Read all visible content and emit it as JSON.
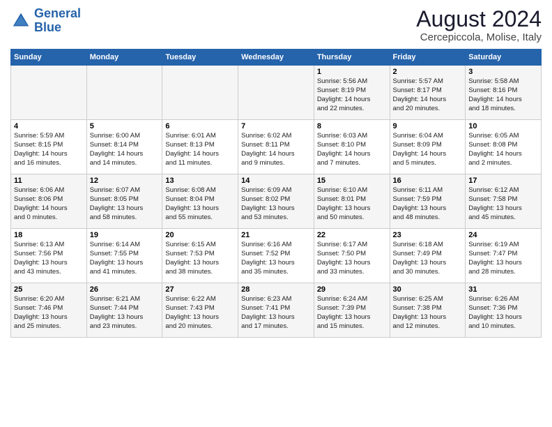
{
  "logo": {
    "line1": "General",
    "line2": "Blue"
  },
  "title": "August 2024",
  "subtitle": "Cercepiccola, Molise, Italy",
  "days_of_week": [
    "Sunday",
    "Monday",
    "Tuesday",
    "Wednesday",
    "Thursday",
    "Friday",
    "Saturday"
  ],
  "weeks": [
    [
      {
        "day": "",
        "info": ""
      },
      {
        "day": "",
        "info": ""
      },
      {
        "day": "",
        "info": ""
      },
      {
        "day": "",
        "info": ""
      },
      {
        "day": "1",
        "info": "Sunrise: 5:56 AM\nSunset: 8:19 PM\nDaylight: 14 hours\nand 22 minutes."
      },
      {
        "day": "2",
        "info": "Sunrise: 5:57 AM\nSunset: 8:17 PM\nDaylight: 14 hours\nand 20 minutes."
      },
      {
        "day": "3",
        "info": "Sunrise: 5:58 AM\nSunset: 8:16 PM\nDaylight: 14 hours\nand 18 minutes."
      }
    ],
    [
      {
        "day": "4",
        "info": "Sunrise: 5:59 AM\nSunset: 8:15 PM\nDaylight: 14 hours\nand 16 minutes."
      },
      {
        "day": "5",
        "info": "Sunrise: 6:00 AM\nSunset: 8:14 PM\nDaylight: 14 hours\nand 14 minutes."
      },
      {
        "day": "6",
        "info": "Sunrise: 6:01 AM\nSunset: 8:13 PM\nDaylight: 14 hours\nand 11 minutes."
      },
      {
        "day": "7",
        "info": "Sunrise: 6:02 AM\nSunset: 8:11 PM\nDaylight: 14 hours\nand 9 minutes."
      },
      {
        "day": "8",
        "info": "Sunrise: 6:03 AM\nSunset: 8:10 PM\nDaylight: 14 hours\nand 7 minutes."
      },
      {
        "day": "9",
        "info": "Sunrise: 6:04 AM\nSunset: 8:09 PM\nDaylight: 14 hours\nand 5 minutes."
      },
      {
        "day": "10",
        "info": "Sunrise: 6:05 AM\nSunset: 8:08 PM\nDaylight: 14 hours\nand 2 minutes."
      }
    ],
    [
      {
        "day": "11",
        "info": "Sunrise: 6:06 AM\nSunset: 8:06 PM\nDaylight: 14 hours\nand 0 minutes."
      },
      {
        "day": "12",
        "info": "Sunrise: 6:07 AM\nSunset: 8:05 PM\nDaylight: 13 hours\nand 58 minutes."
      },
      {
        "day": "13",
        "info": "Sunrise: 6:08 AM\nSunset: 8:04 PM\nDaylight: 13 hours\nand 55 minutes."
      },
      {
        "day": "14",
        "info": "Sunrise: 6:09 AM\nSunset: 8:02 PM\nDaylight: 13 hours\nand 53 minutes."
      },
      {
        "day": "15",
        "info": "Sunrise: 6:10 AM\nSunset: 8:01 PM\nDaylight: 13 hours\nand 50 minutes."
      },
      {
        "day": "16",
        "info": "Sunrise: 6:11 AM\nSunset: 7:59 PM\nDaylight: 13 hours\nand 48 minutes."
      },
      {
        "day": "17",
        "info": "Sunrise: 6:12 AM\nSunset: 7:58 PM\nDaylight: 13 hours\nand 45 minutes."
      }
    ],
    [
      {
        "day": "18",
        "info": "Sunrise: 6:13 AM\nSunset: 7:56 PM\nDaylight: 13 hours\nand 43 minutes."
      },
      {
        "day": "19",
        "info": "Sunrise: 6:14 AM\nSunset: 7:55 PM\nDaylight: 13 hours\nand 41 minutes."
      },
      {
        "day": "20",
        "info": "Sunrise: 6:15 AM\nSunset: 7:53 PM\nDaylight: 13 hours\nand 38 minutes."
      },
      {
        "day": "21",
        "info": "Sunrise: 6:16 AM\nSunset: 7:52 PM\nDaylight: 13 hours\nand 35 minutes."
      },
      {
        "day": "22",
        "info": "Sunrise: 6:17 AM\nSunset: 7:50 PM\nDaylight: 13 hours\nand 33 minutes."
      },
      {
        "day": "23",
        "info": "Sunrise: 6:18 AM\nSunset: 7:49 PM\nDaylight: 13 hours\nand 30 minutes."
      },
      {
        "day": "24",
        "info": "Sunrise: 6:19 AM\nSunset: 7:47 PM\nDaylight: 13 hours\nand 28 minutes."
      }
    ],
    [
      {
        "day": "25",
        "info": "Sunrise: 6:20 AM\nSunset: 7:46 PM\nDaylight: 13 hours\nand 25 minutes."
      },
      {
        "day": "26",
        "info": "Sunrise: 6:21 AM\nSunset: 7:44 PM\nDaylight: 13 hours\nand 23 minutes."
      },
      {
        "day": "27",
        "info": "Sunrise: 6:22 AM\nSunset: 7:43 PM\nDaylight: 13 hours\nand 20 minutes."
      },
      {
        "day": "28",
        "info": "Sunrise: 6:23 AM\nSunset: 7:41 PM\nDaylight: 13 hours\nand 17 minutes."
      },
      {
        "day": "29",
        "info": "Sunrise: 6:24 AM\nSunset: 7:39 PM\nDaylight: 13 hours\nand 15 minutes."
      },
      {
        "day": "30",
        "info": "Sunrise: 6:25 AM\nSunset: 7:38 PM\nDaylight: 13 hours\nand 12 minutes."
      },
      {
        "day": "31",
        "info": "Sunrise: 6:26 AM\nSunset: 7:36 PM\nDaylight: 13 hours\nand 10 minutes."
      }
    ]
  ]
}
